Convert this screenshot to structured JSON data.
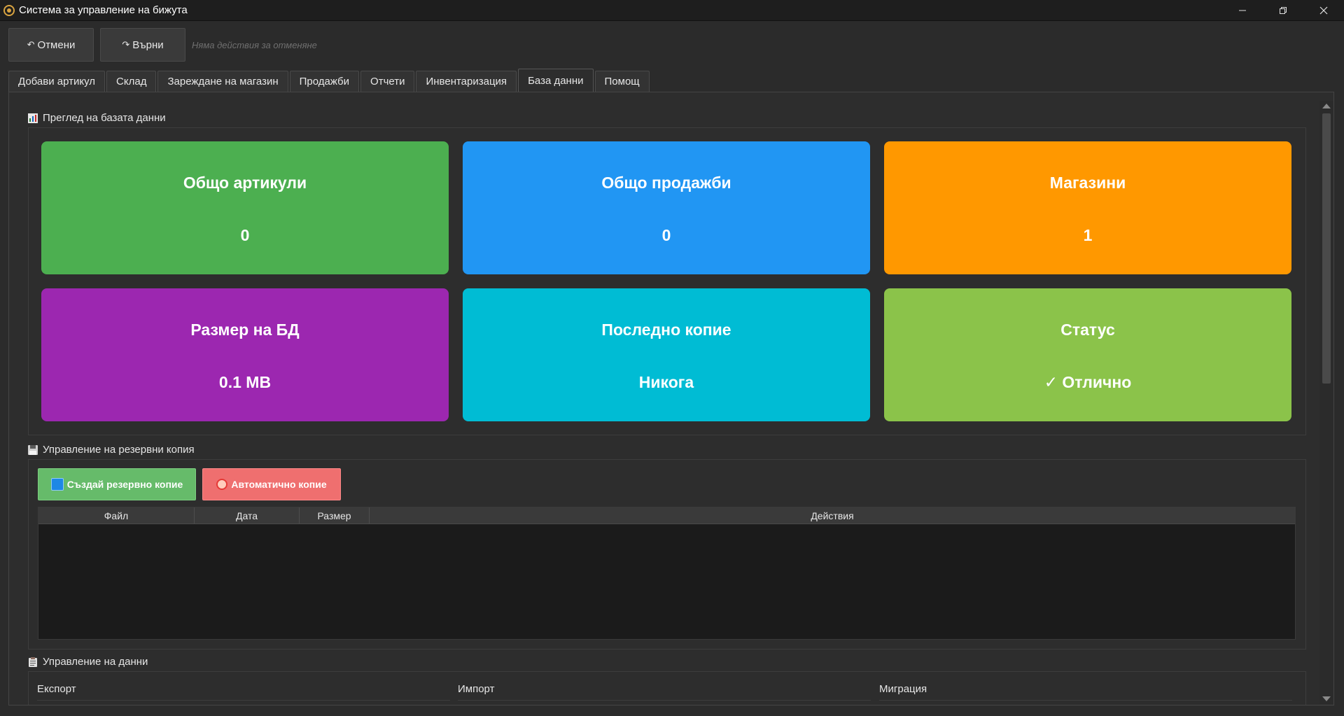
{
  "window": {
    "title": "Система за управление на бижута"
  },
  "toolbar": {
    "undo_label": "Отмени",
    "redo_label": "Върни",
    "hint": "Няма действия за отменяне"
  },
  "tabs": [
    {
      "label": "Добави артикул"
    },
    {
      "label": "Склад"
    },
    {
      "label": "Зареждане на магазин"
    },
    {
      "label": "Продажби"
    },
    {
      "label": "Отчети"
    },
    {
      "label": "Инвентаризация"
    },
    {
      "label": "База данни"
    },
    {
      "label": "Помощ"
    }
  ],
  "active_tab": "База данни",
  "overview": {
    "title": "Преглед на базата данни",
    "icon": "bar-chart-icon",
    "cards": [
      {
        "title": "Общо артикули",
        "value": "0",
        "color": "#4caf50"
      },
      {
        "title": "Общо продажби",
        "value": "0",
        "color": "#2196f3"
      },
      {
        "title": "Магазини",
        "value": "1",
        "color": "#ff9800"
      },
      {
        "title": "Размер на БД",
        "value": "0.1 MB",
        "color": "#9c27b0"
      },
      {
        "title": "Последно копие",
        "value": "Никога",
        "color": "#00bcd4"
      },
      {
        "title": "Статус",
        "value": "✓ Отлично",
        "color": "#8bc34a"
      }
    ]
  },
  "backup": {
    "title": "Управление на резервни копия",
    "icon": "floppy-disk-icon",
    "create_label": "Създай резервно копие",
    "auto_label": "Автоматично копие",
    "columns": [
      "Файл",
      "Дата",
      "Размер",
      "Действия"
    ],
    "rows": []
  },
  "data_management": {
    "title": "Управление на данни",
    "icon": "clipboard-icon",
    "sections": [
      {
        "label": "Експорт"
      },
      {
        "label": "Импорт"
      },
      {
        "label": "Миграция"
      }
    ]
  },
  "colors": {
    "background": "#2b2b2b",
    "create_button": "#66bb6a",
    "auto_button": "#ef6f6f"
  }
}
